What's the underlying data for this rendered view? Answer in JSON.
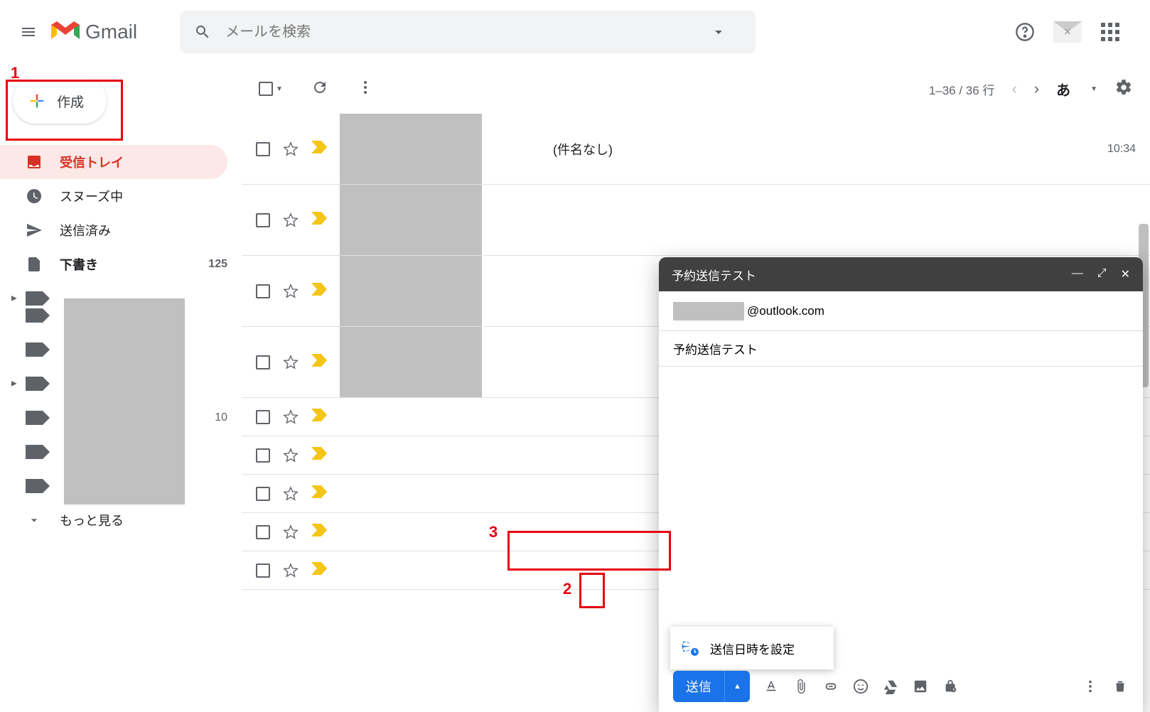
{
  "header": {
    "app_name": "Gmail",
    "search_placeholder": "メールを検索"
  },
  "sidebar": {
    "compose_label": "作成",
    "items": [
      {
        "label": "受信トレイ",
        "active": true
      },
      {
        "label": "スヌーズ中"
      },
      {
        "label": "送信済み"
      },
      {
        "label": "下書き",
        "count": "125",
        "bold": true
      }
    ],
    "label_count": "10",
    "more_label": "もっと見る"
  },
  "toolbar": {
    "range": "1–36 / 36 行",
    "ime": "あ"
  },
  "mail": {
    "subject_none": "(件名なし)",
    "time": "10:34"
  },
  "compose": {
    "title": "予約送信テスト",
    "to_suffix": "@outlook.com",
    "subject": "予約送信テスト",
    "send_label": "送信",
    "schedule_label": "送信日時を設定"
  },
  "annotations": {
    "a1": "1",
    "a2": "2",
    "a3": "3"
  }
}
